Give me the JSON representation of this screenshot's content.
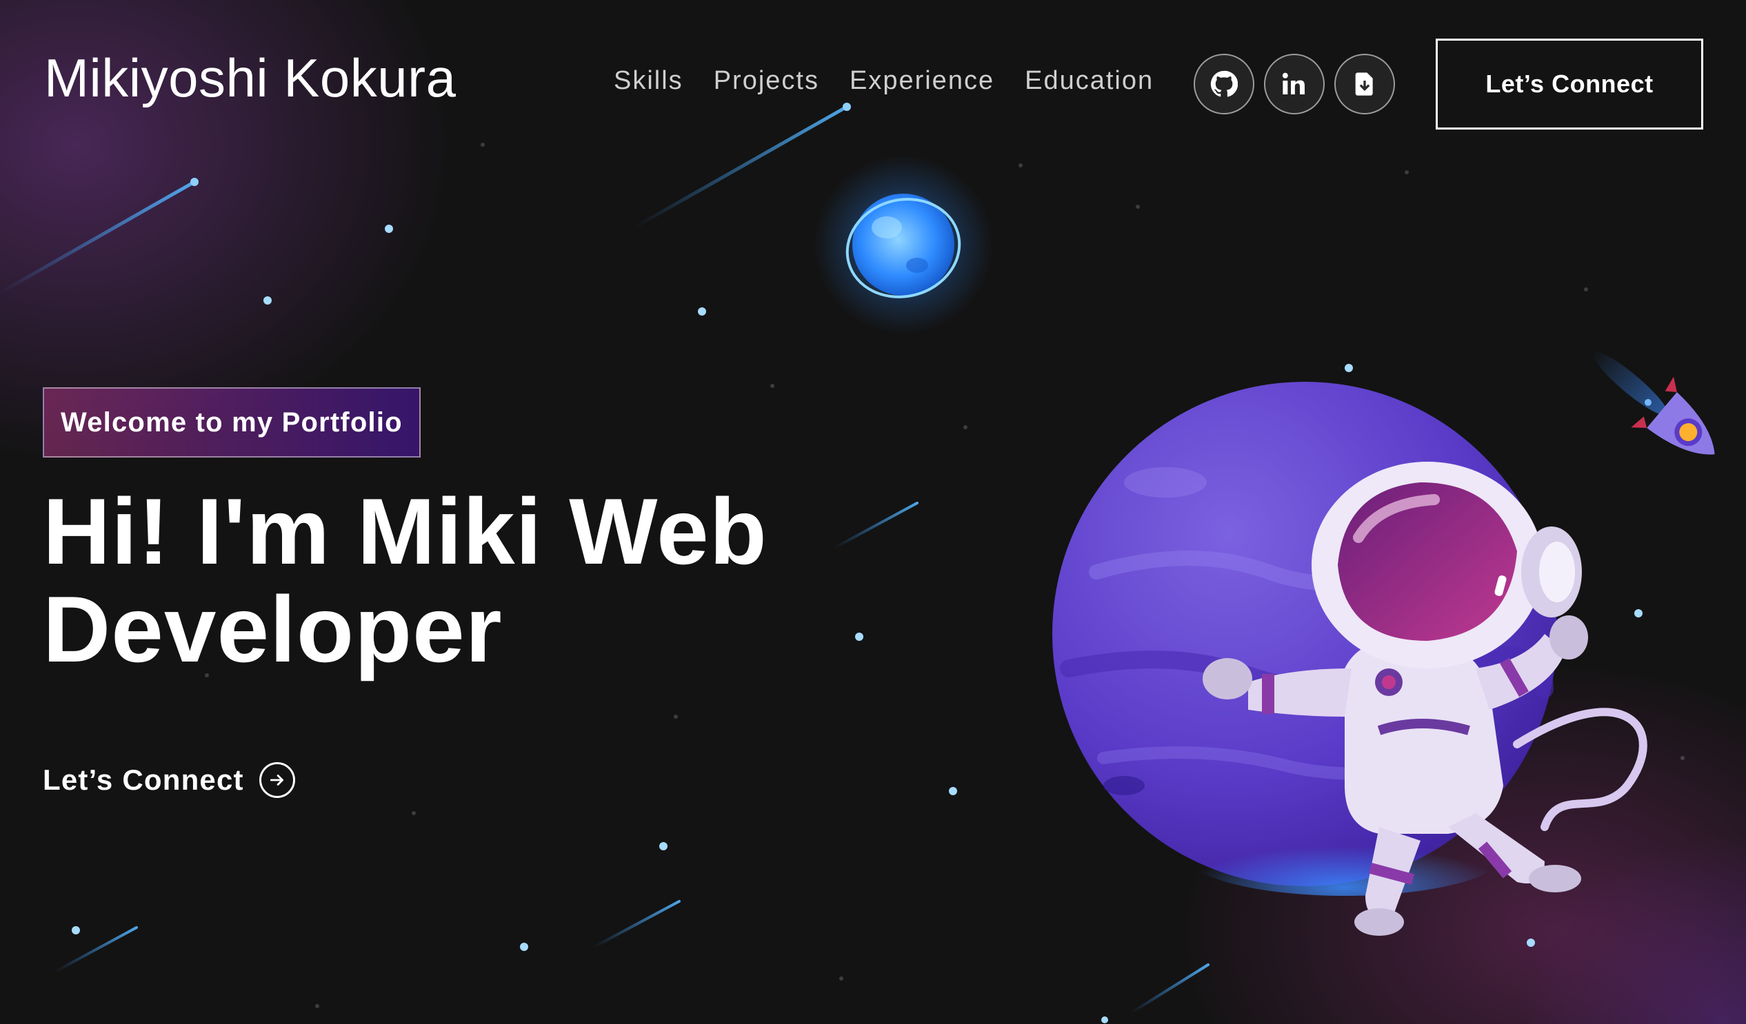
{
  "navbar": {
    "brand": "Mikiyoshi Kokura",
    "links": [
      "Skills",
      "Projects",
      "Experience",
      "Education"
    ],
    "social": [
      {
        "icon": "github-icon"
      },
      {
        "icon": "linkedin-icon"
      },
      {
        "icon": "resume-download-icon"
      }
    ],
    "connect_label": "Let’s Connect"
  },
  "hero": {
    "tagline": "Welcome to my Portfolio",
    "headline_line1": "Hi! I'm Miki Web",
    "headline_line2": "Developer",
    "cta_label": "Let’s Connect",
    "cta_icon": "arrow-right-circle-icon"
  },
  "colors": {
    "background": "#131313",
    "text": "#ffffff",
    "accent_pink": "#aa367c",
    "accent_violet": "#4a2fbd"
  }
}
